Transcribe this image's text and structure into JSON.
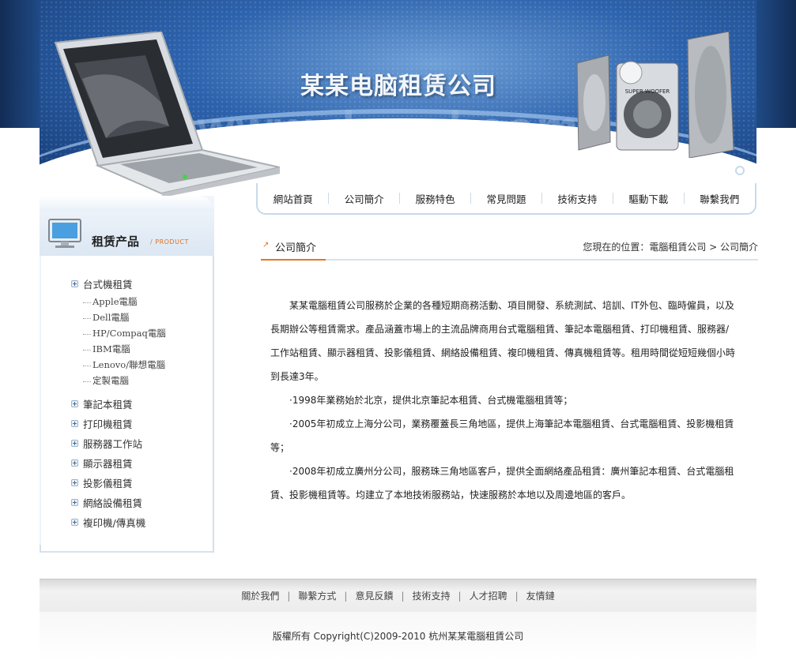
{
  "banner": {
    "company_name": "某某电脑租赁公司",
    "watermark": "www.drccd.com"
  },
  "nav": {
    "items": [
      "網站首頁",
      "公司簡介",
      "服務特色",
      "常見問題",
      "技術支持",
      "驅動下載",
      "聯繫我們"
    ]
  },
  "sidebar": {
    "title": "租赁产品",
    "subtitle": "/ PRODUCT",
    "categories": [
      {
        "label": "台式機租賃",
        "children": [
          "Apple電腦",
          "Dell電腦",
          "HP/Compaq電腦",
          "IBM電腦",
          "Lenovo/聯想電腦",
          "定製電腦"
        ]
      },
      {
        "label": "筆記本租賃"
      },
      {
        "label": "打印機租賃"
      },
      {
        "label": "服務器工作站"
      },
      {
        "label": "顯示器租賃"
      },
      {
        "label": "投影儀租賃"
      },
      {
        "label": "網絡設備租賃"
      },
      {
        "label": "複印機/傳真機"
      }
    ]
  },
  "main": {
    "title": "公司簡介",
    "breadcrumb": "您現在的位置：電腦租賃公司 > 公司簡介",
    "paragraphs": [
      "某某電腦租賃公司服務於企業的各種短期商務活動、項目開發、系統測試、培訓、IT外包、臨時僱員，以及長期辦公等租賃需求。產品涵蓋市場上的主流品牌商用台式電腦租賃、筆記本電腦租賃、打印機租賃、服務器/工作站租賃、顯示器租賃、投影儀租賃、網絡設備租賃、複印機租賃、傳真機租賃等。租用時間從短短幾個小時到長達3年。",
      "·1998年業務始於北京，提供北京筆記本租賃、台式機電腦租賃等；",
      "·2005年初成立上海分公司，業務覆蓋長三角地區，提供上海筆記本電腦租賃、台式電腦租賃、投影機租賃等；",
      "·2008年初成立廣州分公司，服務珠三角地區客戶，提供全面網絡產品租賃：廣州筆記本租賃、台式電腦租賃、投影機租賃等。均建立了本地技術服務站，快速服務於本地以及周邊地區的客戶。"
    ]
  },
  "footer": {
    "links": [
      "關於我們",
      "聯繫方式",
      "意見反饋",
      "技術支持",
      "人才招聘",
      "友情鏈"
    ],
    "separator": "|",
    "copyright": "版權所有 Copyright(C)2009-2010 杭州某某電腦租賃公司"
  },
  "colors": {
    "accent": "#e8751e",
    "banner_blue": "#2d63ad",
    "border_blue": "#c8d9ea"
  }
}
